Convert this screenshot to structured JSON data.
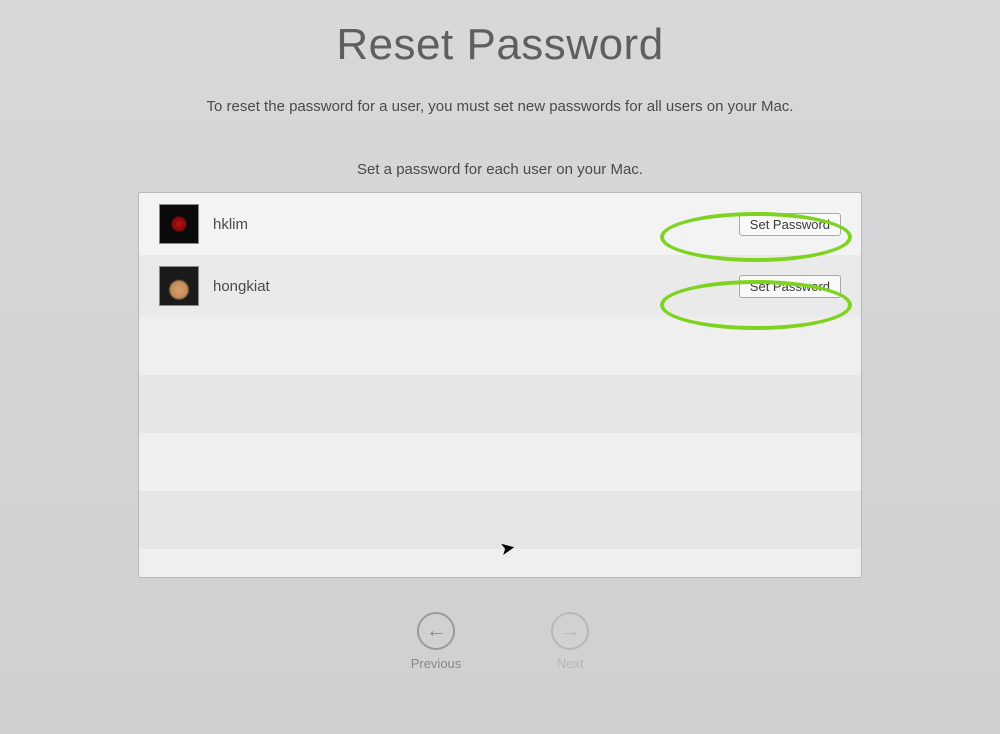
{
  "title": "Reset Password",
  "instruction": "To reset the password for a user, you must set new passwords for all users on your Mac.",
  "subtitle": "Set a password for each user on your Mac.",
  "users": [
    {
      "name": "hklim",
      "button": "Set Password"
    },
    {
      "name": "hongkiat",
      "button": "Set Password"
    }
  ],
  "nav": {
    "previous": "Previous",
    "next": "Next"
  }
}
